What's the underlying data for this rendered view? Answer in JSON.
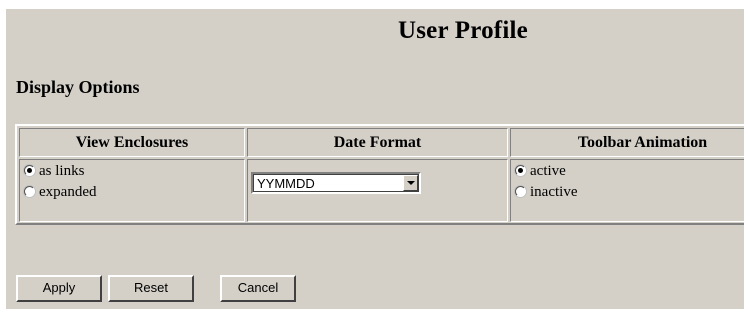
{
  "page": {
    "title": "User Profile"
  },
  "section": {
    "title": "Display Options"
  },
  "columns": {
    "view_enclosures": {
      "header": "View Enclosures",
      "options": [
        {
          "label": "as links",
          "checked": true
        },
        {
          "label": "expanded",
          "checked": false
        }
      ]
    },
    "date_format": {
      "header": "Date Format",
      "selected": "YYMMDD"
    },
    "toolbar_animation": {
      "header": "Toolbar Animation",
      "options": [
        {
          "label": "active",
          "checked": true
        },
        {
          "label": "inactive",
          "checked": false
        }
      ]
    }
  },
  "buttons": {
    "apply": "Apply",
    "reset": "Reset",
    "cancel": "Cancel"
  },
  "icons": {
    "dropdown": "chevron-down-icon"
  },
  "colors": {
    "background": "#d4d0c8",
    "page": "#ffffff"
  }
}
